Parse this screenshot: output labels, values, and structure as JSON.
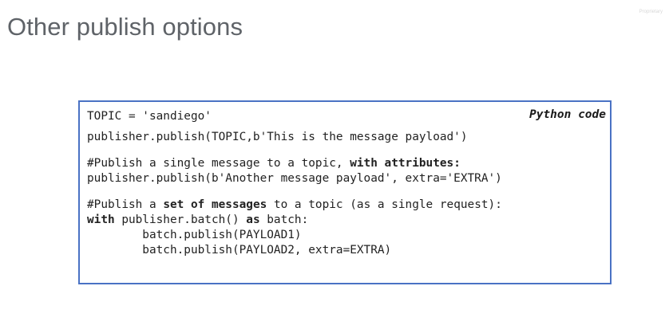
{
  "slide": {
    "title": "Other publish options",
    "watermark": "Proprietary"
  },
  "code_box": {
    "label": "Python code",
    "border_color": "#4a72c4",
    "lines": {
      "l1": "TOPIC = 'sandiego'",
      "l2": "publisher.publish(TOPIC,b'This is the message payload')",
      "l3_a": "#Publish a single message to a topic, ",
      "l3_b": "with attributes:",
      "l4": "publisher.publish(b'Another message payload', extra='EXTRA')",
      "l5_a": "#Publish a ",
      "l5_b": "set of messages",
      "l5_c": " to a topic (as a single request):",
      "l6_a": "with",
      "l6_b": " publisher.batch() ",
      "l6_c": "as",
      "l6_d": " batch:",
      "l7": "        batch.publish(PAYLOAD1)",
      "l8": "        batch.publish(PAYLOAD2, extra=EXTRA)"
    }
  }
}
